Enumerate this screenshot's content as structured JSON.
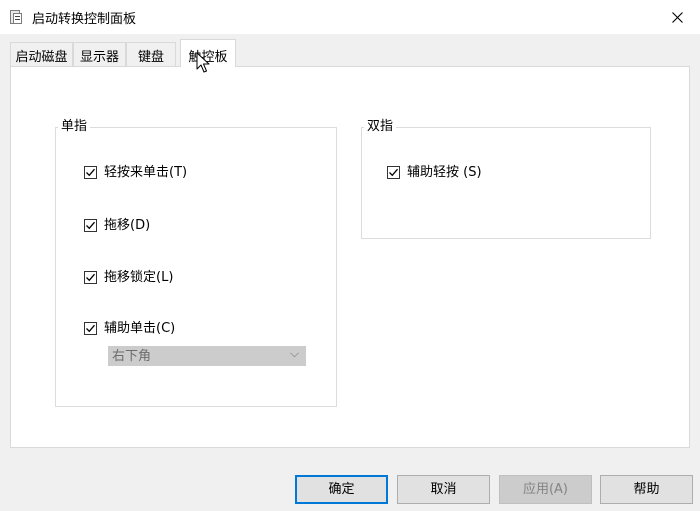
{
  "window": {
    "title": "启动转换控制面板"
  },
  "tabs": [
    {
      "label": "启动磁盘",
      "active": false
    },
    {
      "label": "显示器",
      "active": false
    },
    {
      "label": "键盘",
      "active": false
    },
    {
      "label": "触控板",
      "active": true
    }
  ],
  "single_finger": {
    "legend": "单指",
    "options": [
      {
        "label": "轻按来单击(T)",
        "checked": true
      },
      {
        "label": "拖移(D)",
        "checked": true
      },
      {
        "label": "拖移锁定(L)",
        "checked": true
      },
      {
        "label": "辅助单击(C)",
        "checked": true
      }
    ],
    "secondary_click_corner": {
      "value": "右下角",
      "enabled": false
    }
  },
  "two_finger": {
    "legend": "双指",
    "options": [
      {
        "label": "辅助轻按 (S)",
        "checked": true
      }
    ]
  },
  "buttons": {
    "ok": "确定",
    "cancel": "取消",
    "apply": "应用(A)",
    "help": "帮助"
  },
  "colors": {
    "accent": "#0078d7",
    "disabled_fill": "#cccccc"
  },
  "icons": {
    "app": "control-panel-icon",
    "close": "close-icon",
    "check": "checkmark-icon",
    "dropdown": "chevron-down-icon",
    "cursor": "mouse-pointer-icon"
  }
}
